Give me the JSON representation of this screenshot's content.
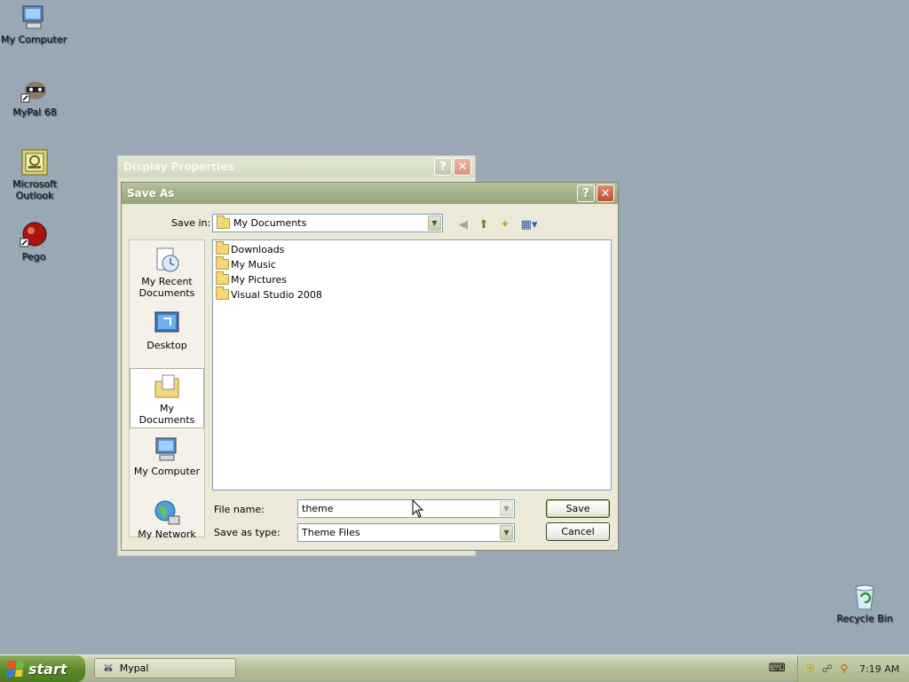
{
  "desktop": {
    "icons": [
      {
        "label": "My Computer"
      },
      {
        "label": "MyPal 68"
      },
      {
        "label": "Microsoft Outlook"
      },
      {
        "label": "Pego"
      },
      {
        "label": "Recycle Bin"
      }
    ]
  },
  "bg_window": {
    "title": "Display Properties",
    "help_glyph": "?",
    "close_glyph": "✕"
  },
  "dialog": {
    "title": "Save As",
    "help_glyph": "?",
    "close_glyph": "✕",
    "save_in_label": "Save in:",
    "save_in_value": "My Documents",
    "places": [
      {
        "label": "My Recent Documents"
      },
      {
        "label": "Desktop"
      },
      {
        "label": "My Documents"
      },
      {
        "label": "My Computer"
      },
      {
        "label": "My Network"
      }
    ],
    "files": [
      {
        "name": "Downloads"
      },
      {
        "name": "My Music"
      },
      {
        "name": "My Pictures"
      },
      {
        "name": "Visual Studio 2008"
      }
    ],
    "file_name_label": "File name:",
    "file_name_value": "theme",
    "save_type_label": "Save as type:",
    "save_type_value": "Theme Files",
    "save_button": "Save",
    "cancel_button": "Cancel"
  },
  "taskbar": {
    "start_label": "start",
    "task_label": "Mypal",
    "clock": "7:19 AM"
  },
  "colors": {
    "desktop": "#9aa7b4",
    "titlebar": "#a3b088",
    "close": "#c9482b"
  }
}
